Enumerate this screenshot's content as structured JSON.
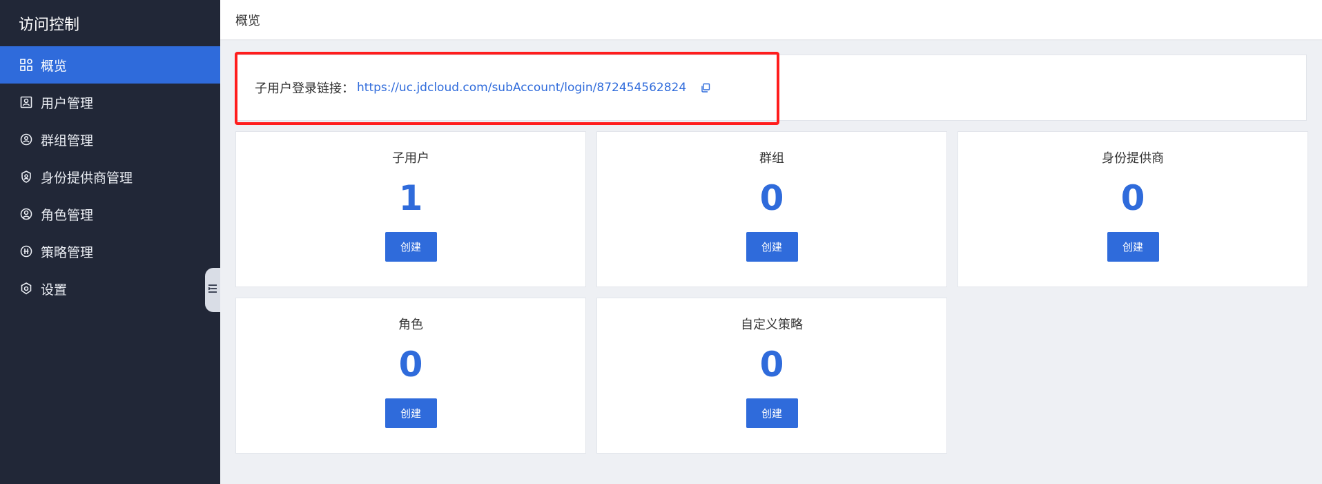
{
  "sidebar": {
    "title": "访问控制",
    "items": [
      {
        "label": "概览",
        "icon": "overview-icon",
        "active": true
      },
      {
        "label": "用户管理",
        "icon": "user-card-icon",
        "active": false
      },
      {
        "label": "群组管理",
        "icon": "group-icon",
        "active": false
      },
      {
        "label": "身份提供商管理",
        "icon": "identity-provider-icon",
        "active": false
      },
      {
        "label": "角色管理",
        "icon": "role-icon",
        "active": false
      },
      {
        "label": "策略管理",
        "icon": "policy-icon",
        "active": false
      },
      {
        "label": "设置",
        "icon": "settings-icon",
        "active": false
      }
    ]
  },
  "header": {
    "title": "概览"
  },
  "login": {
    "label": "子用户登录链接：",
    "url": "https://uc.jdcloud.com/subAccount/login/872454562824"
  },
  "cards": [
    {
      "title": "子用户",
      "count": "1",
      "button": "创建"
    },
    {
      "title": "群组",
      "count": "0",
      "button": "创建"
    },
    {
      "title": "身份提供商",
      "count": "0",
      "button": "创建"
    },
    {
      "title": "角色",
      "count": "0",
      "button": "创建"
    },
    {
      "title": "自定义策略",
      "count": "0",
      "button": "创建"
    }
  ],
  "colors": {
    "sidebar_bg": "#212737",
    "accent": "#2f6bdb",
    "highlight": "#ff1d1d"
  }
}
